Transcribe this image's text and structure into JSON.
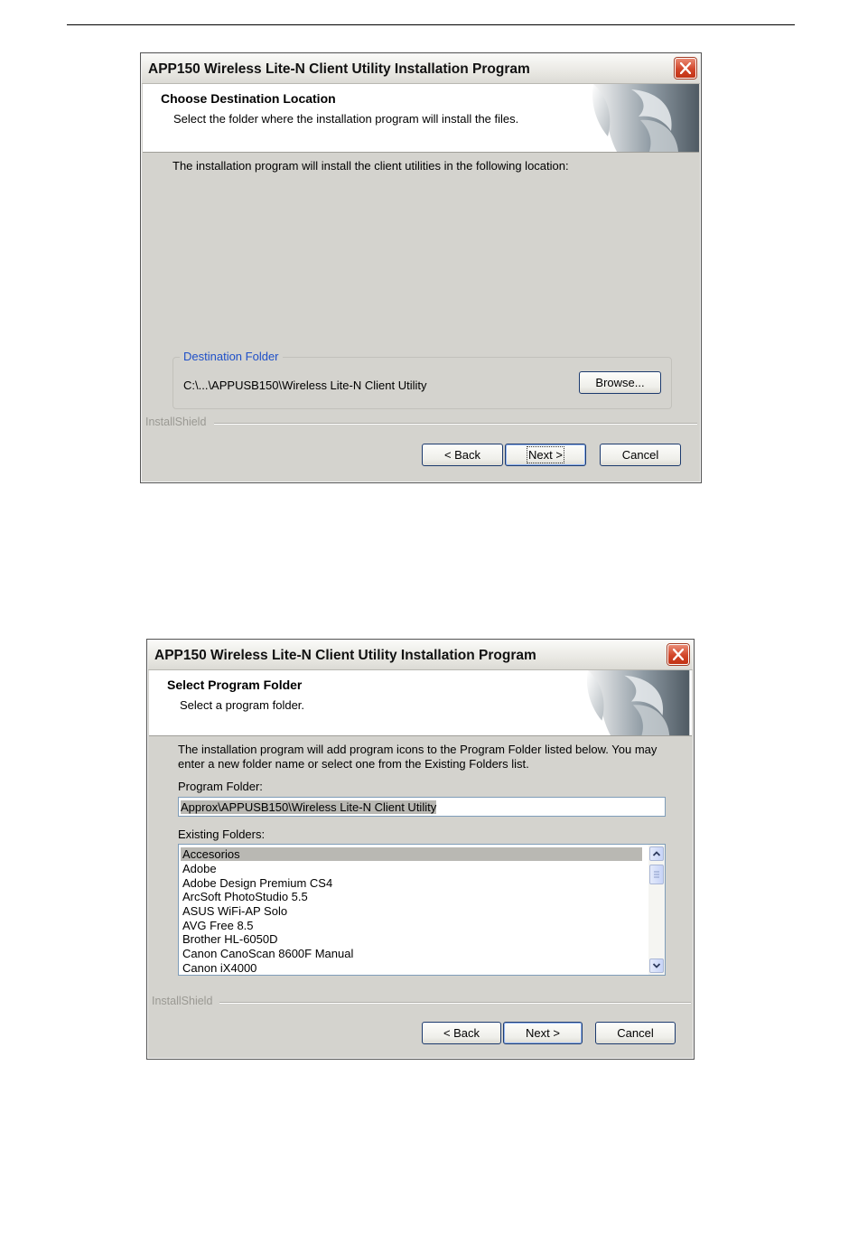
{
  "dialog1": {
    "title": "APP150 Wireless Lite-N Client Utility Installation Program",
    "header_title": "Choose Destination Location",
    "header_sub": "Select the folder where the installation program will install the files.",
    "body_text": "The installation program will install the client utilities in the following location:",
    "group_label": "Destination Folder",
    "path": "C:\\...\\APPUSB150\\Wireless Lite-N Client Utility",
    "browse_label": "Browse...",
    "brand": "InstallShield",
    "back_label": "< Back",
    "next_label": "Next >",
    "cancel_label": "Cancel"
  },
  "dialog2": {
    "title": "APP150 Wireless Lite-N Client Utility Installation Program",
    "header_title": "Select Program Folder",
    "header_sub": "Select a program folder.",
    "body_line1": "The installation program will add program icons to the Program Folder listed below. You may",
    "body_line2": "enter a new folder name or select one from the Existing Folders list.",
    "program_folder_label": "Program Folder:",
    "program_folder_value": "Approx\\APPUSB150\\Wireless Lite-N Client Utility",
    "existing_folders_label": "Existing Folders:",
    "existing_folders": [
      "Accesorios",
      "Adobe",
      "Adobe Design Premium CS4",
      "ArcSoft PhotoStudio 5.5",
      "ASUS WiFi-AP Solo",
      "AVG Free 8.5",
      "Brother HL-6050D",
      "Canon CanoScan 8600F Manual",
      "Canon iX4000"
    ],
    "brand": "InstallShield",
    "back_label": "< Back",
    "next_label": "Next >",
    "cancel_label": "Cancel"
  },
  "icons": {
    "close": "close-icon",
    "logo": "installshield-logo",
    "scroll_up": "chevron-up-icon",
    "scroll_down": "chevron-down-icon"
  },
  "colors": {
    "dialog_bg": "#d4d3ce",
    "close_button": "#d2462a",
    "group_label": "#1f50c8"
  }
}
